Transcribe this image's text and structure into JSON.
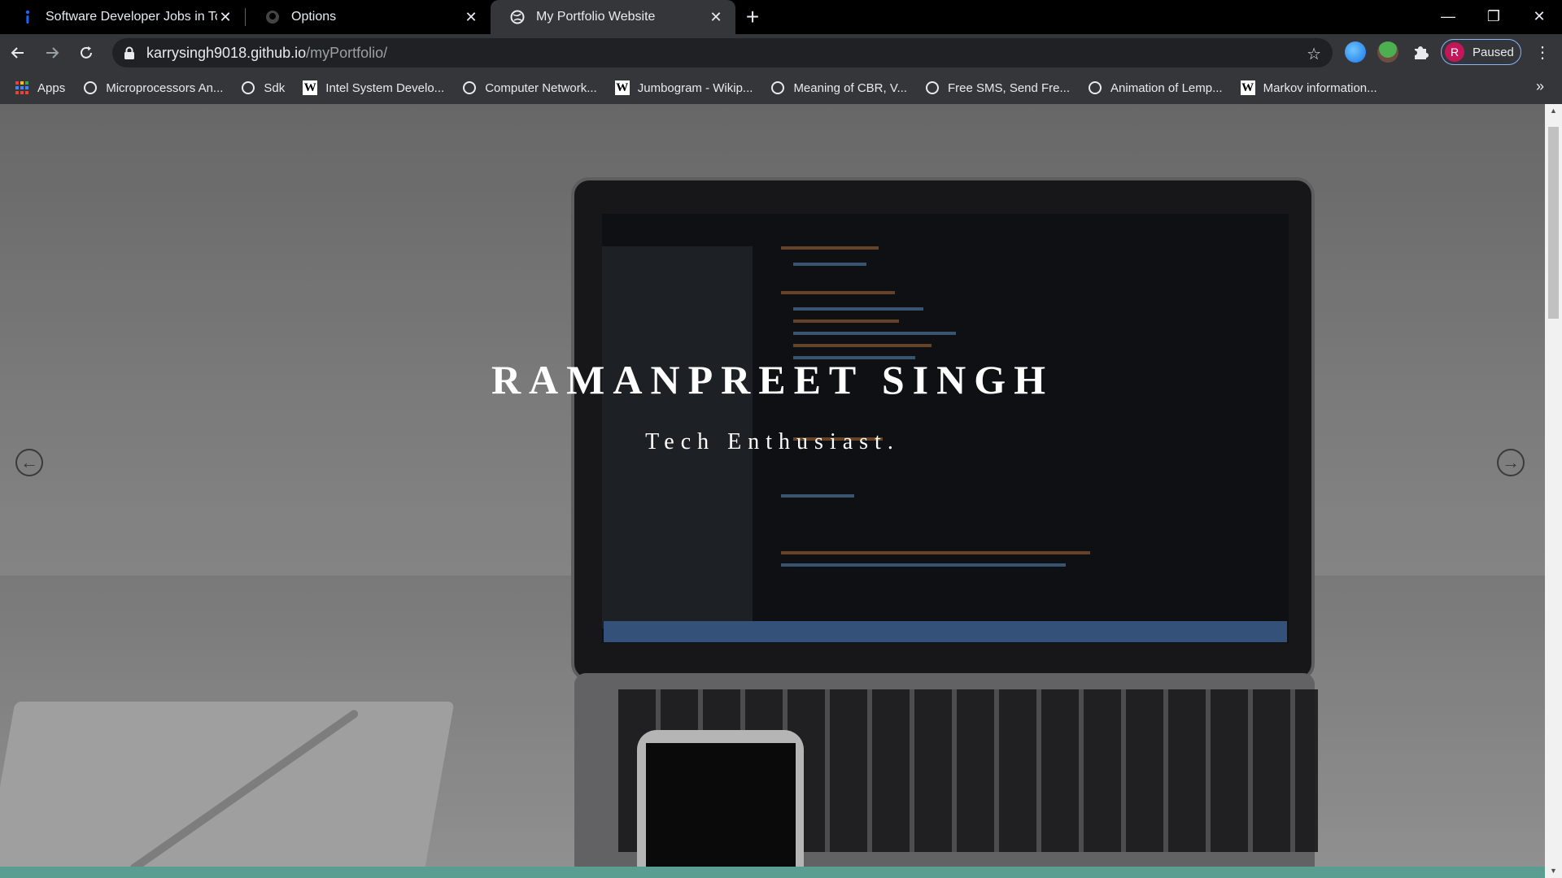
{
  "tabs": [
    {
      "title": "Software Developer Jobs in Toron",
      "icon": "indeed-icon",
      "active": false
    },
    {
      "title": "Options",
      "icon": "github-icon",
      "active": false
    },
    {
      "title": "My Portfolio Website",
      "icon": "globe-icon",
      "active": true
    }
  ],
  "window": {
    "minimize": "—",
    "restore": "❐",
    "close": "✕",
    "new_tab": "+"
  },
  "toolbar": {
    "url_host": "karrysingh9018.github.io",
    "url_path": "/myPortfolio/",
    "profile_initial": "R",
    "profile_status": "Paused"
  },
  "bookmarks": [
    {
      "label": "Apps",
      "icon": "apps-grid-icon"
    },
    {
      "label": "Microprocessors An...",
      "icon": "globe-icon"
    },
    {
      "label": "Sdk",
      "icon": "globe-icon"
    },
    {
      "label": "Intel System Develo...",
      "icon": "wikipedia-icon"
    },
    {
      "label": "Computer Network...",
      "icon": "globe-icon"
    },
    {
      "label": "Jumbogram - Wikip...",
      "icon": "wikipedia-icon"
    },
    {
      "label": "Meaning of CBR, V...",
      "icon": "globe-icon"
    },
    {
      "label": "Free SMS, Send Fre...",
      "icon": "globe-icon"
    },
    {
      "label": "Animation of Lemp...",
      "icon": "globe-icon"
    },
    {
      "label": "Markov information...",
      "icon": "wikipedia-icon"
    }
  ],
  "hero": {
    "title": "RAMANPREET SINGH",
    "subtitle": "Tech Enthusiast."
  },
  "colors": {
    "accent_bar": "#5a9e92",
    "profile_ring": "#8ab4f8",
    "avatar": "#c2185b"
  }
}
